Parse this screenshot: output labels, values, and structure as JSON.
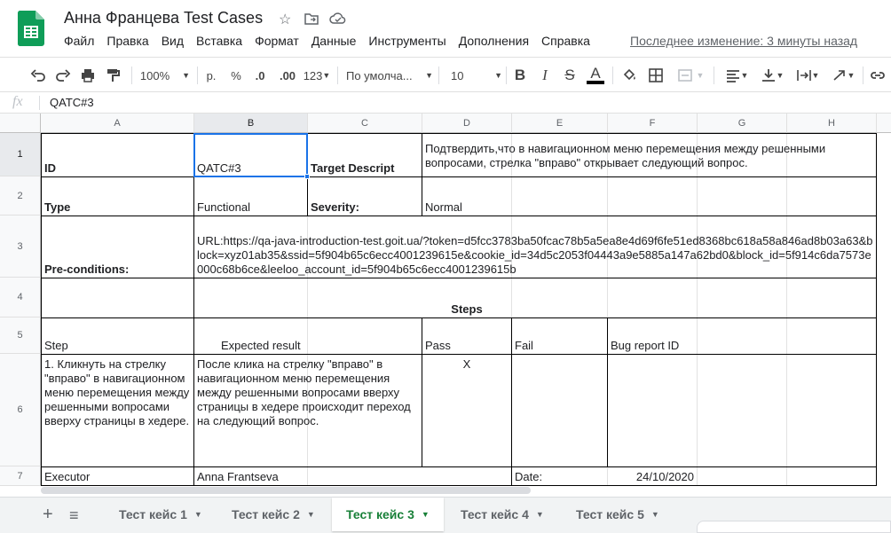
{
  "doc": {
    "title": "Анна Францева Test Cases",
    "last_edit": "Последнее изменение: 3 минуты назад"
  },
  "menu": [
    "Файл",
    "Правка",
    "Вид",
    "Вставка",
    "Формат",
    "Данные",
    "Инструменты",
    "Дополнения",
    "Справка"
  ],
  "toolbar": {
    "zoom": "100%",
    "currency": "р.",
    "percent": "%",
    "dec_less": ".0",
    "dec_more": ".00",
    "format_more": "123",
    "font": "По умолча...",
    "font_size": "10",
    "bold": "B",
    "italic": "I",
    "strike": "S",
    "text_color": "A"
  },
  "formula": {
    "fx": "fx",
    "value": "QATC#3"
  },
  "columns": [
    "A",
    "B",
    "C",
    "D",
    "E",
    "F",
    "G",
    "H"
  ],
  "rows": [
    "1",
    "2",
    "3",
    "4",
    "5",
    "6",
    "7"
  ],
  "cells": {
    "A1": "ID",
    "B1": "QATC#3",
    "C1": "Target Descript",
    "D1": "Подтвердить,что в навигационном меню перемещения между решенными вопросами, стрелка \"вправо\" открывает следующий вопрос.",
    "A2": "Type",
    "B2": "Functional",
    "C2": "Severity:",
    "D2": "Normal",
    "A3": "Pre-conditions:",
    "B3": "URL:https://qa-java-introduction-test.goit.ua/?token=d5fcc3783ba50fcac78b5a5ea8e4d69f6fe51ed8368bc618a58a846ad8b03a63&block=xyz01ab35&ssid=5f904b65c6ecc4001239615e&cookie_id=34d5c2053f04443a9e5885a147a62bd0&block_id=5f914c6da7573e000c68b6ce&leeloo_account_id=5f904b65c6ecc4001239615b",
    "D4": "Steps",
    "A5": "Step",
    "B5": "Expected result",
    "D5": "Pass",
    "E5": "Fail",
    "F5": "Bug report ID",
    "A6": "1. Кликнуть на стрелку \"вправо\" в навигационном меню перемещения между решенными вопросами вверху страницы в хедере.",
    "B6": "После клика  на стрелку \"вправо\" в навигационном меню перемещения между решенными вопросами вверху страницы в хедере происходит переход на следующий вопрос.",
    "D6": "X",
    "A7": "Executor",
    "B7": "Anna Frantseva",
    "E7": "Date:",
    "F7": "24/10/2020"
  },
  "sheets": [
    "Тест кейс 1",
    "Тест кейс 2",
    "Тест кейс 3",
    "Тест кейс 4",
    "Тест кейс 5"
  ],
  "active_sheet": "Тест кейс 3",
  "colors": {
    "accent": "#1a73e8",
    "active_tab": "#188038",
    "sheets_green": "#0f9d58"
  }
}
